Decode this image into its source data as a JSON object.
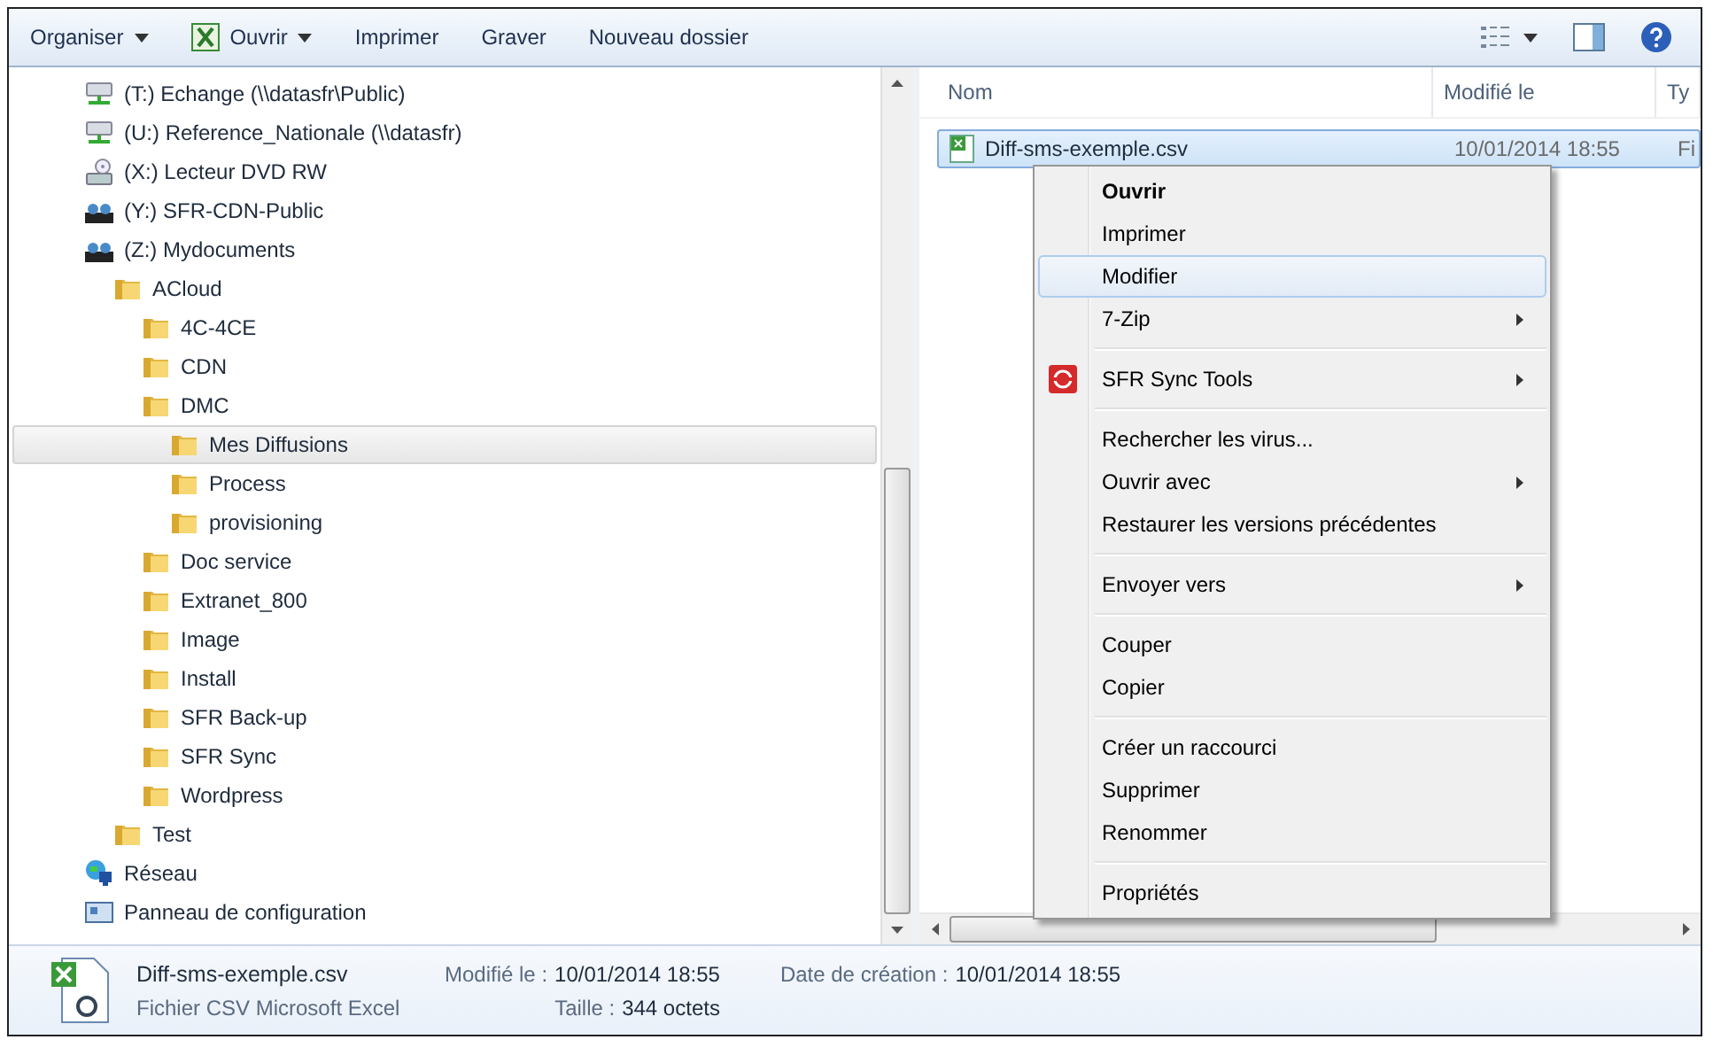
{
  "toolbar": {
    "left": [
      {
        "label": "Organiser",
        "kind": "menu"
      },
      {
        "label": "Ouvrir",
        "kind": "open"
      },
      {
        "label": "Imprimer",
        "kind": "plain"
      },
      {
        "label": "Graver",
        "kind": "plain"
      },
      {
        "label": "Nouveau dossier",
        "kind": "plain"
      }
    ]
  },
  "tree": [
    {
      "label": "(T:) Echange (\\\\datasfr\\Public)",
      "kind": "network-drive",
      "selected": false
    },
    {
      "label": "(U:) Reference_Nationale (\\\\datasfr)",
      "kind": "network-drive",
      "selected": false
    },
    {
      "label": "(X:) Lecteur DVD RW",
      "kind": "dvd",
      "selected": false
    },
    {
      "label": "(Y:) SFR-CDN-Public",
      "kind": "shared",
      "selected": false
    },
    {
      "label": "(Z:) Mydocuments",
      "kind": "shared",
      "selected": false,
      "children": [
        {
          "label": "ACloud",
          "kind": "folder",
          "selected": false,
          "children": [
            {
              "label": "4C-4CE",
              "kind": "folder",
              "selected": false
            },
            {
              "label": "CDN",
              "kind": "folder",
              "selected": false
            },
            {
              "label": "DMC",
              "kind": "folder",
              "selected": false,
              "children": [
                {
                  "label": "Mes Diffusions",
                  "kind": "folder",
                  "selected": true
                },
                {
                  "label": "Process",
                  "kind": "folder",
                  "selected": false
                },
                {
                  "label": "provisioning",
                  "kind": "folder",
                  "selected": false
                }
              ]
            },
            {
              "label": "Doc service",
              "kind": "folder",
              "selected": false
            },
            {
              "label": "Extranet_800",
              "kind": "folder",
              "selected": false
            },
            {
              "label": "Image",
              "kind": "folder",
              "selected": false
            },
            {
              "label": "Install",
              "kind": "folder",
              "selected": false
            },
            {
              "label": "SFR Back-up",
              "kind": "folder",
              "selected": false
            },
            {
              "label": "SFR Sync",
              "kind": "folder",
              "selected": false
            },
            {
              "label": "Wordpress",
              "kind": "folder",
              "selected": false
            }
          ]
        },
        {
          "label": "Test",
          "kind": "folder",
          "selected": false
        }
      ]
    },
    {
      "label": "Réseau",
      "kind": "network",
      "selected": false
    },
    {
      "label": "Panneau de configuration",
      "kind": "control-panel",
      "selected": false
    }
  ],
  "columns": [
    "Nom",
    "Modifié le",
    "Ty"
  ],
  "files": [
    {
      "name": "Diff-sms-exemple.csv",
      "modified": "10/01/2014 18:55",
      "type": "Fi",
      "selected": true
    }
  ],
  "context_menu": [
    {
      "kind": "item",
      "label": "Ouvrir",
      "default": true,
      "selected": false
    },
    {
      "kind": "item",
      "label": "Imprimer",
      "selected": false
    },
    {
      "kind": "item",
      "label": "Modifier",
      "selected": true
    },
    {
      "kind": "item",
      "label": "7-Zip",
      "submenu": true,
      "selected": false
    },
    {
      "kind": "separator"
    },
    {
      "kind": "icon-item",
      "label": "SFR Sync Tools",
      "submenu": true,
      "selected": false
    },
    {
      "kind": "separator"
    },
    {
      "kind": "item",
      "label": "Rechercher les virus...",
      "selected": false
    },
    {
      "kind": "item",
      "label": "Ouvrir avec",
      "submenu": true,
      "selected": false
    },
    {
      "kind": "item",
      "label": "Restaurer les versions précédentes",
      "selected": false
    },
    {
      "kind": "separator"
    },
    {
      "kind": "item",
      "label": "Envoyer vers",
      "submenu": true,
      "selected": false
    },
    {
      "kind": "separator"
    },
    {
      "kind": "item",
      "label": "Couper",
      "selected": false
    },
    {
      "kind": "item",
      "label": "Copier",
      "selected": false
    },
    {
      "kind": "separator"
    },
    {
      "kind": "item",
      "label": "Créer un raccourci",
      "selected": false
    },
    {
      "kind": "item",
      "label": "Supprimer",
      "selected": false
    },
    {
      "kind": "item",
      "label": "Renommer",
      "selected": false
    },
    {
      "kind": "separator"
    },
    {
      "kind": "item",
      "label": "Propriétés",
      "selected": false
    }
  ],
  "details": {
    "name": "Diff-sms-exemple.csv",
    "type": "Fichier CSV Microsoft Excel",
    "fields": [
      {
        "label": "Modifié le :",
        "value": "10/01/2014 18:55"
      },
      {
        "label": "Taille :",
        "value": "344 octets"
      },
      {
        "label": "Date de création :",
        "value": "10/01/2014 18:55"
      }
    ]
  }
}
